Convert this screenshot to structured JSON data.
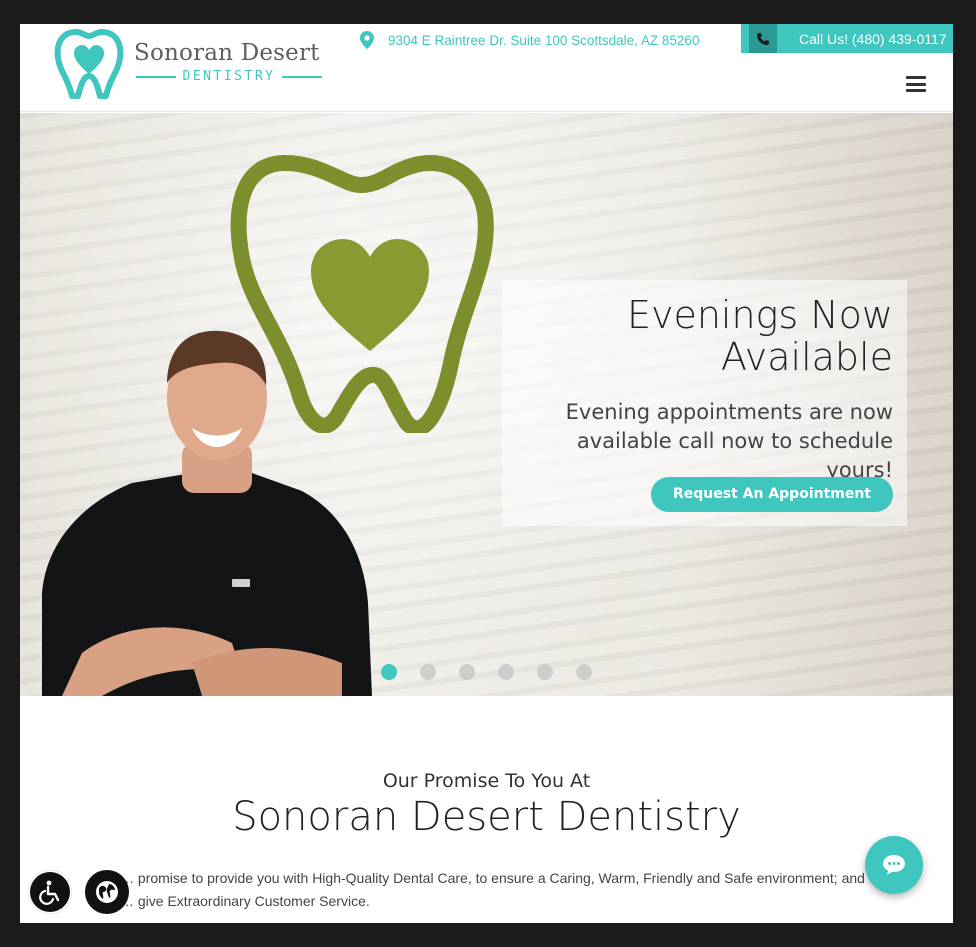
{
  "brand": {
    "name": "Sonoran Desert",
    "subtitle": "DENTISTRY"
  },
  "topbar": {
    "address": "9304 E Raintree Dr. Suite 100 Scottsdale, AZ 85260",
    "call_label": "Call Us! (480) 439-0117"
  },
  "hero": {
    "title_line1": "Evenings Now",
    "title_line2": "Available",
    "text_line1": "Evening appointments are now",
    "text_line2": "available call now to schedule yours!",
    "cta_label": "Request An Appointment",
    "slides": 6,
    "active_slide": 1
  },
  "promise": {
    "kicker": "Our Promise To You At",
    "title": "Sonoran Desert Dentistry",
    "body_line1": "… promise to provide you with High-Quality Dental Care, to ensure a Caring, Warm, Friendly and Safe environment; and",
    "body_line2": "… give Extraordinary Customer Service."
  },
  "colors": {
    "accent": "#3ec6bf",
    "frame": "#1b1b1b"
  },
  "icons": {
    "location": "map-pin-icon",
    "phone": "phone-icon",
    "menu": "hamburger-menu-icon",
    "accessibility": "wheelchair-icon",
    "language": "globe-icon",
    "chat": "chat-bubble-icon"
  }
}
